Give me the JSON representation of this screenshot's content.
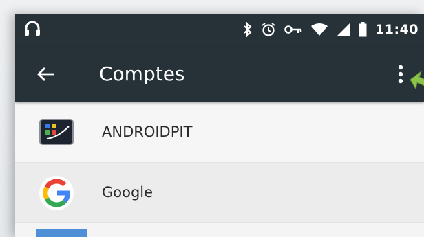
{
  "status_bar": {
    "time": "11:40",
    "icons": [
      "headset-icon",
      "bluetooth-icon",
      "alarm-icon",
      "vpn-key-icon",
      "wifi-icon",
      "signal-icon",
      "battery-icon"
    ]
  },
  "toolbar": {
    "title": "Comptes",
    "back_icon": "arrow-back-icon",
    "menu_icon": "more-vert-icon",
    "background": "#263238"
  },
  "accounts": [
    {
      "label": "ANDROIDPIT",
      "icon": "androidpit-app-icon"
    },
    {
      "label": "Google",
      "icon": "google-g-icon"
    }
  ],
  "annotation": {
    "pointer_color": "#8bc34a",
    "pointer_icon": "green-arrow-pointer"
  }
}
